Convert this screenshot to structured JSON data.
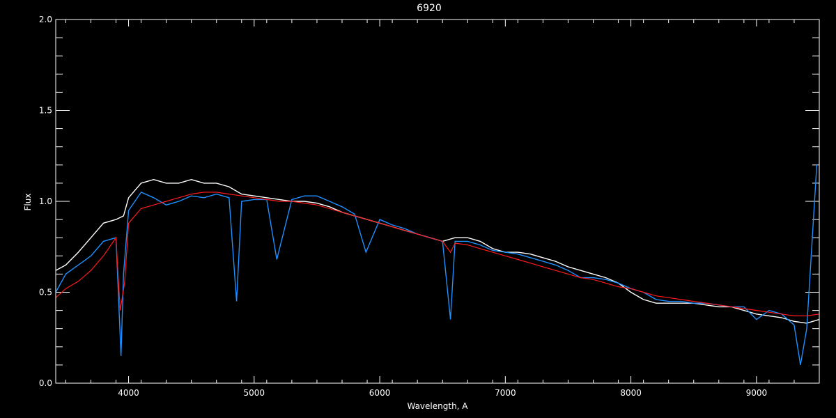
{
  "chart_data": {
    "type": "line",
    "title": "6920",
    "xlabel": "Wavelength, A",
    "ylabel": "Flux",
    "xlim": [
      3420,
      9500
    ],
    "ylim": [
      0,
      2
    ],
    "xticks": [
      4000,
      5000,
      6000,
      7000,
      8000,
      9000
    ],
    "xtick_labels": [
      "4000",
      "5000",
      "6000",
      "7000",
      "8000",
      "9000"
    ],
    "yticks": [
      0,
      0.5,
      1,
      1.5,
      2
    ],
    "ytick_labels": [
      "0.0",
      "0.5",
      "1.0",
      "1.5",
      "2.0"
    ],
    "grid": false,
    "legend": "none",
    "background": "#000000",
    "series": [
      {
        "color": "#ffffff",
        "x": [
          3420,
          3500,
          3600,
          3700,
          3800,
          3900,
          3960,
          4000,
          4100,
          4200,
          4300,
          4400,
          4500,
          4600,
          4700,
          4800,
          4900,
          5000,
          5100,
          5200,
          5300,
          5400,
          5500,
          5600,
          5700,
          5800,
          5900,
          6000,
          6100,
          6200,
          6300,
          6400,
          6500,
          6600,
          6700,
          6800,
          6900,
          7000,
          7100,
          7200,
          7300,
          7400,
          7500,
          7600,
          7700,
          7800,
          7900,
          8000,
          8100,
          8200,
          8300,
          8400,
          8500,
          8600,
          8700,
          8800,
          8900,
          9000,
          9100,
          9200,
          9300,
          9400,
          9500
        ],
        "y": [
          0.62,
          0.65,
          0.72,
          0.8,
          0.88,
          0.9,
          0.92,
          1.02,
          1.1,
          1.12,
          1.1,
          1.1,
          1.12,
          1.1,
          1.1,
          1.08,
          1.04,
          1.03,
          1.02,
          1.01,
          1.0,
          1.0,
          0.99,
          0.97,
          0.94,
          0.92,
          0.9,
          0.88,
          0.86,
          0.84,
          0.82,
          0.8,
          0.78,
          0.8,
          0.8,
          0.78,
          0.74,
          0.72,
          0.72,
          0.71,
          0.69,
          0.67,
          0.64,
          0.62,
          0.6,
          0.58,
          0.55,
          0.5,
          0.46,
          0.44,
          0.44,
          0.44,
          0.44,
          0.43,
          0.42,
          0.42,
          0.4,
          0.38,
          0.37,
          0.36,
          0.34,
          0.33,
          0.35
        ]
      },
      {
        "color": "#1e90ff",
        "x": [
          3420,
          3500,
          3600,
          3700,
          3800,
          3900,
          3940,
          3960,
          4000,
          4100,
          4200,
          4300,
          4400,
          4500,
          4600,
          4700,
          4800,
          4860,
          4900,
          5000,
          5100,
          5180,
          5300,
          5400,
          5500,
          5600,
          5700,
          5800,
          5890,
          6000,
          6100,
          6200,
          6300,
          6400,
          6500,
          6563,
          6600,
          6700,
          6800,
          6900,
          7000,
          7100,
          7200,
          7300,
          7400,
          7500,
          7600,
          7700,
          7800,
          7900,
          8000,
          8100,
          8200,
          8300,
          8400,
          8500,
          8600,
          8700,
          8800,
          8900,
          9000,
          9100,
          9200,
          9300,
          9350,
          9400,
          9480
        ],
        "y": [
          0.5,
          0.6,
          0.65,
          0.7,
          0.78,
          0.8,
          0.15,
          0.6,
          0.95,
          1.05,
          1.02,
          0.98,
          1.0,
          1.03,
          1.02,
          1.04,
          1.02,
          0.45,
          1.0,
          1.01,
          1.01,
          0.68,
          1.01,
          1.03,
          1.03,
          1.0,
          0.97,
          0.93,
          0.72,
          0.9,
          0.87,
          0.85,
          0.82,
          0.8,
          0.78,
          0.35,
          0.78,
          0.78,
          0.76,
          0.73,
          0.72,
          0.71,
          0.69,
          0.67,
          0.65,
          0.62,
          0.58,
          0.58,
          0.57,
          0.55,
          0.52,
          0.5,
          0.46,
          0.45,
          0.45,
          0.44,
          0.44,
          0.43,
          0.42,
          0.42,
          0.35,
          0.4,
          0.38,
          0.32,
          0.1,
          0.3,
          1.2
        ]
      },
      {
        "color": "#ff1a1a",
        "x": [
          3420,
          3500,
          3600,
          3700,
          3800,
          3900,
          3933,
          3968,
          4000,
          4100,
          4200,
          4300,
          4400,
          4500,
          4600,
          4700,
          4800,
          4900,
          5000,
          5100,
          5200,
          5300,
          5400,
          5500,
          5600,
          5700,
          5800,
          5900,
          6000,
          6100,
          6200,
          6300,
          6400,
          6500,
          6563,
          6600,
          6700,
          6800,
          6900,
          7000,
          7100,
          7200,
          7300,
          7400,
          7500,
          7600,
          7700,
          7800,
          7900,
          8000,
          8100,
          8200,
          8300,
          8400,
          8500,
          8600,
          8700,
          8800,
          8900,
          9000,
          9100,
          9200,
          9300,
          9400,
          9500
        ],
        "y": [
          0.47,
          0.52,
          0.56,
          0.62,
          0.7,
          0.8,
          0.4,
          0.55,
          0.88,
          0.96,
          0.98,
          1.0,
          1.02,
          1.04,
          1.05,
          1.05,
          1.04,
          1.03,
          1.02,
          1.01,
          1.0,
          1.0,
          0.99,
          0.98,
          0.96,
          0.94,
          0.92,
          0.9,
          0.88,
          0.86,
          0.84,
          0.82,
          0.8,
          0.78,
          0.72,
          0.77,
          0.76,
          0.74,
          0.72,
          0.7,
          0.68,
          0.66,
          0.64,
          0.62,
          0.6,
          0.58,
          0.57,
          0.55,
          0.53,
          0.52,
          0.5,
          0.48,
          0.47,
          0.46,
          0.45,
          0.44,
          0.43,
          0.42,
          0.41,
          0.4,
          0.39,
          0.38,
          0.37,
          0.37,
          0.38
        ]
      }
    ]
  }
}
